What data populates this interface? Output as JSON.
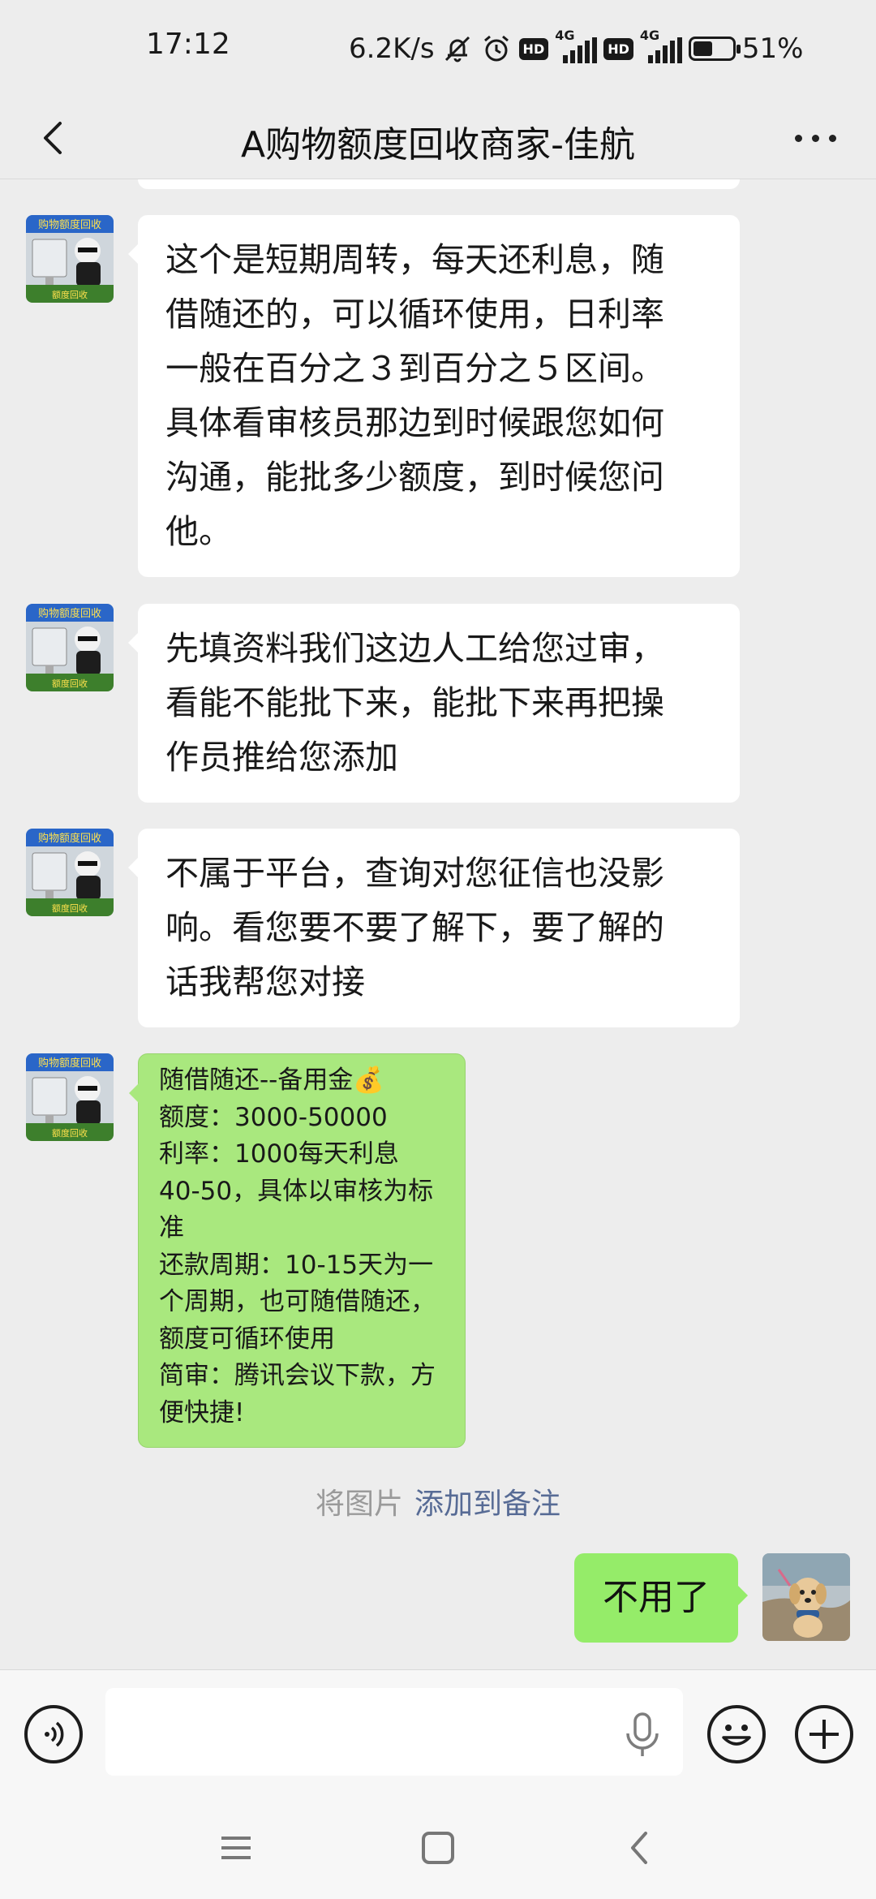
{
  "status_bar": {
    "time": "17:12",
    "network_speed": "6.2K/s",
    "hd_label": "HD",
    "signal_label": "4G",
    "battery_text": "51%",
    "battery_level": 0.51
  },
  "header": {
    "title": "A购物额度回收商家-佳航"
  },
  "messages": [
    {
      "sender": "other",
      "lines": [
        "这个是短期周转，每天还利息，随",
        "借随还的，可以循环使用，日利率",
        "一般在百分之３到百分之５区间。",
        "具体看审核员那边到时候跟您如何",
        "沟通，能批多少额度，到时候您问",
        "他。"
      ]
    },
    {
      "sender": "other",
      "lines": [
        "先填资料我们这边人工给您过审，",
        "看能不能批下来，能批下来再把操",
        "作员推给您添加"
      ]
    },
    {
      "sender": "other",
      "lines": [
        "不属于平台，查询对您征信也没影",
        "响。看您要不要了解下，要了解的",
        "话我帮您对接"
      ]
    },
    {
      "sender": "other",
      "image_message": true,
      "lines": [
        "随借随还--备用金💰",
        "额度：3000-50000",
        "利率：1000每天利息",
        "40-50，具体以审核为标",
        "准",
        "还款周期：10-15天为一",
        "个周期，也可随借随还，",
        "额度可循环使用",
        "简审：腾讯会议下款，方",
        "便快捷!"
      ]
    }
  ],
  "system_note": {
    "prefix": "将图片",
    "link": "添加到备注"
  },
  "my_message": {
    "text": "不用了"
  },
  "avatar_labels": {
    "banner": "购物额度回收",
    "footer": "额度回收"
  },
  "input": {
    "value": "",
    "placeholder": ""
  },
  "icons": {
    "back": "back-arrow-icon",
    "more": "more-icon",
    "voice": "voice-icon",
    "mic": "mic-icon",
    "emoji": "emoji-icon",
    "plus": "plus-icon",
    "menu": "menu-icon",
    "home": "home-icon",
    "nav_back": "nav-back-icon"
  },
  "colors": {
    "chat_bg": "#ededed",
    "my_bubble": "#95ec69",
    "image_bubble": "#a9e87e",
    "link": "#576b95"
  }
}
